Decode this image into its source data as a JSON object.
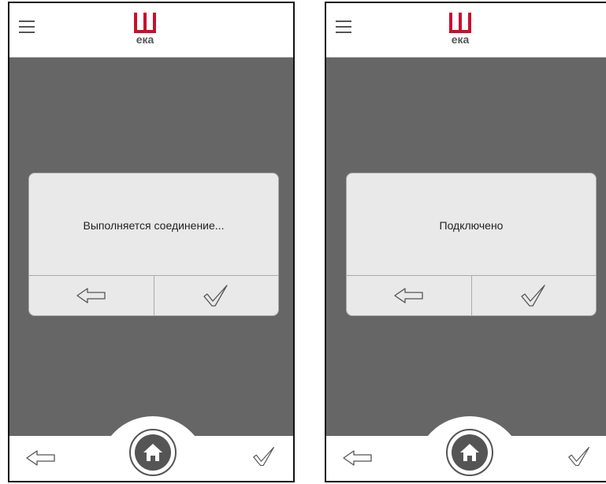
{
  "brand": {
    "logo_text": "ека",
    "logo_color": "#c8102e"
  },
  "screens": [
    {
      "dialog": {
        "message": "Выполняется соединение...",
        "back_icon": "arrow-left-icon",
        "confirm_icon": "checkmark-icon"
      }
    },
    {
      "dialog": {
        "message": "Подключено",
        "back_icon": "arrow-left-icon",
        "confirm_icon": "checkmark-icon"
      }
    }
  ],
  "footer": {
    "back_icon": "arrow-left-icon",
    "home_icon": "home-icon",
    "confirm_icon": "checkmark-icon"
  },
  "colors": {
    "background": "#666666",
    "dialog": "#e9e9e9",
    "icon": "#555555"
  }
}
